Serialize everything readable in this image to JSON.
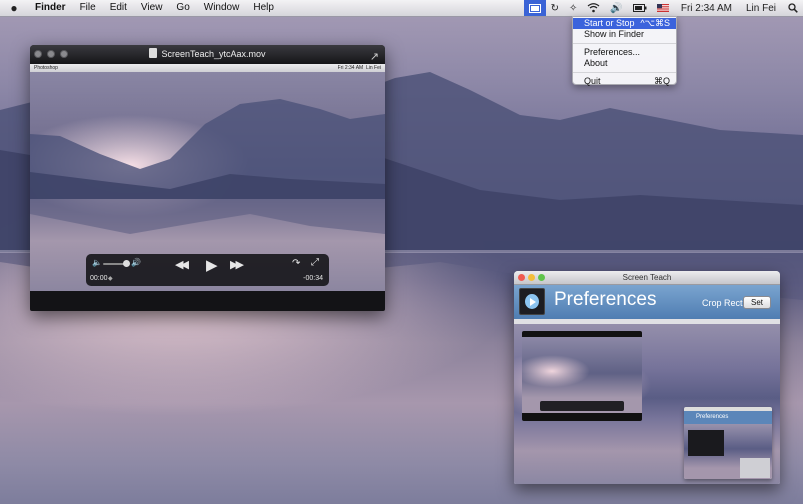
{
  "menubar": {
    "apple_icon": "apple-icon",
    "app_name": "Finder",
    "menus": [
      "File",
      "Edit",
      "View",
      "Go",
      "Window",
      "Help"
    ],
    "status": {
      "clock": "Fri 2:34 AM",
      "user": "Lin Fei"
    }
  },
  "status_menu": {
    "items": [
      {
        "label": "Start or Stop",
        "shortcut": "^⌥⌘S",
        "highlighted": true
      },
      {
        "label": "Show in Finder",
        "shortcut": ""
      },
      {
        "label": "Preferences...",
        "shortcut": ""
      },
      {
        "label": "About",
        "shortcut": ""
      },
      {
        "label": "Quit",
        "shortcut": "⌘Q"
      }
    ]
  },
  "player": {
    "title": "ScreenTeach_ytcAax.mov",
    "inner_menubar": {
      "app": "Photoshop",
      "clock": "Fri 2:34 AM",
      "user": "Lin Fei"
    },
    "controller": {
      "current_time": "00:00",
      "remaining_time": "-00:34",
      "volume_level": 0.9
    }
  },
  "prefs_window": {
    "window_title": "Screen Teach",
    "heading": "Preferences",
    "crop_label": "Crop Rect:",
    "set_button": "Set"
  },
  "colors": {
    "menu_highlight": "#3b63dc",
    "prefs_header": "#5b86b9",
    "close_button": "#ef5b52",
    "minimize_button": "#f3be3c",
    "zoom_button": "#5fc44b"
  }
}
